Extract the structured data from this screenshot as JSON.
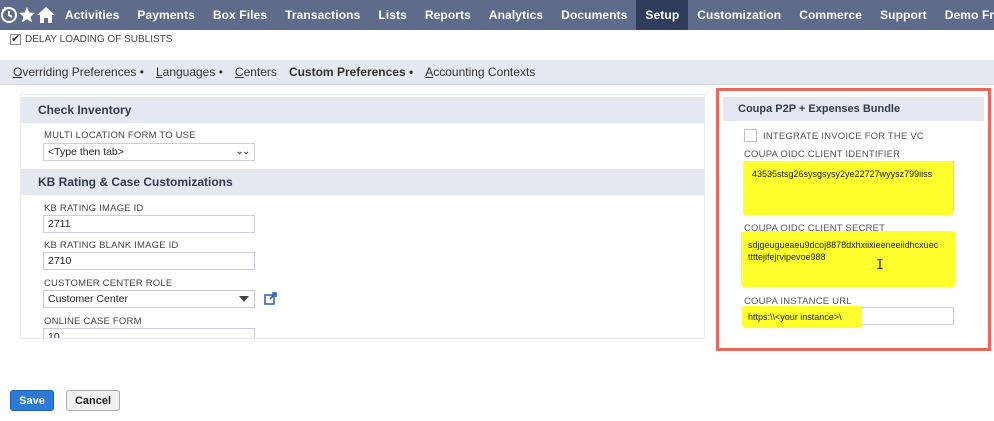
{
  "nav": {
    "items": [
      {
        "label": "Activities",
        "active": false
      },
      {
        "label": "Payments",
        "active": false
      },
      {
        "label": "Box Files",
        "active": false
      },
      {
        "label": "Transactions",
        "active": false
      },
      {
        "label": "Lists",
        "active": false
      },
      {
        "label": "Reports",
        "active": false
      },
      {
        "label": "Analytics",
        "active": false
      },
      {
        "label": "Documents",
        "active": false
      },
      {
        "label": "Setup",
        "active": true
      },
      {
        "label": "Customization",
        "active": false
      },
      {
        "label": "Commerce",
        "active": false
      },
      {
        "label": "Support",
        "active": false
      },
      {
        "label": "Demo Framev",
        "active": false
      }
    ],
    "icons": [
      "recent-records-icon",
      "star-icon",
      "home-icon"
    ],
    "color": "#5e6b8a",
    "active_color": "#2f3d5b"
  },
  "delay": {
    "label": "DELAY LOADING OF SUBLISTS",
    "checked": true
  },
  "subtabs": [
    {
      "text": "Overriding Preferences",
      "ul": "O",
      "rest": "verriding Preferences",
      "dot": true,
      "active": false
    },
    {
      "text": "Languages",
      "ul": "L",
      "rest": "anguages",
      "dot": true,
      "active": false
    },
    {
      "text": "Centers",
      "ul": "C",
      "rest": "enters",
      "dot": false,
      "active": false
    },
    {
      "text": "Custom Preferences",
      "ul": "",
      "rest": "Custom Preferences",
      "dot": true,
      "active": true
    },
    {
      "text": "Accounting Contexts",
      "ul": "A",
      "rest": "ccounting Contexts",
      "dot": false,
      "active": false
    }
  ],
  "left": {
    "check_inventory": {
      "title": "Check Inventory",
      "multi_location_label": "MULTI LOCATION FORM TO USE",
      "multi_location_value": "<Type then tab>"
    },
    "kb": {
      "title": "KB Rating & Case Customizations",
      "rating_image_label": "KB RATING IMAGE ID",
      "rating_image_value": "2711",
      "rating_blank_label": "KB RATING BLANK IMAGE ID",
      "rating_blank_value": "2710",
      "customer_role_label": "CUSTOMER CENTER ROLE",
      "customer_role_value": "Customer Center",
      "online_case_label": "ONLINE CASE FORM",
      "online_case_value": "10"
    }
  },
  "coupa": {
    "title": "Coupa P2P + Expenses Bundle",
    "integrate_label": "INTEGRATE INVOICE FOR THE VC",
    "integrate_checked": false,
    "client_id_label": "COUPA OIDC CLIENT IDENTIFIER",
    "client_id_value": "43535stsg26sysgsysy2ye22727wyysz799iiss",
    "client_secret_label": "COUPA OIDC CLIENT SECRET",
    "client_secret_line1": "sdjgeugueaeu9dcoj8878dxhxiixieeneeiidhcxuec",
    "client_secret_line2": "ttttejifejrvipevoe988",
    "instance_url_label": "COUPA INSTANCE URL",
    "instance_url_value": "https:\\\\<your instance>\\",
    "highlight_color": "#ffff2e",
    "border_color": "#e8685a"
  },
  "actions": {
    "save": "Save",
    "cancel": "Cancel",
    "save_color": "#2a7ad6"
  }
}
